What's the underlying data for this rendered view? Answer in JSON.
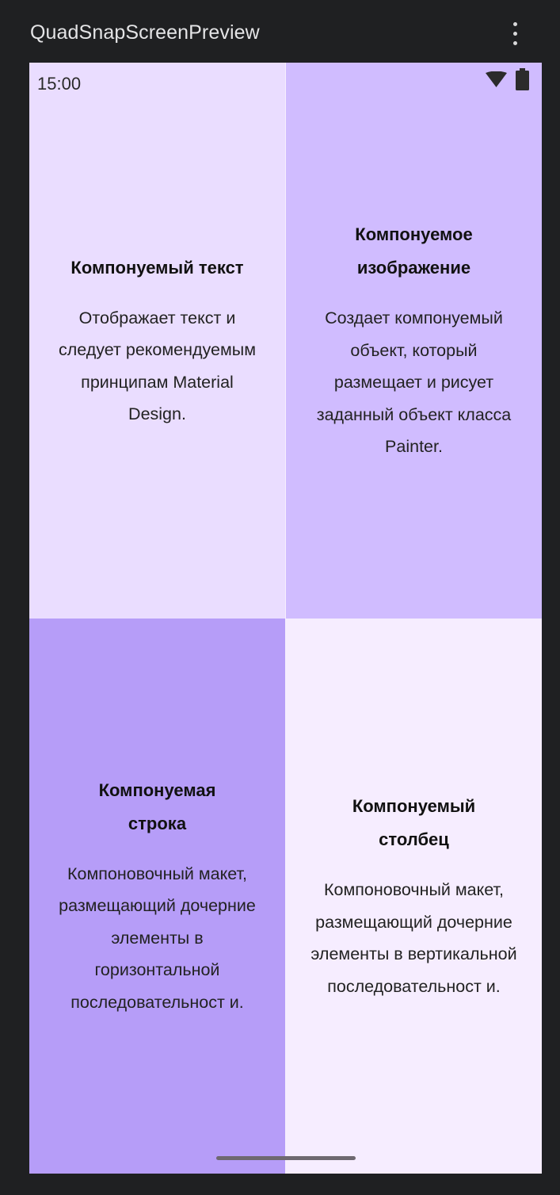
{
  "preview": {
    "title": "QuadSnapScreenPreview",
    "more_icon": "more-vert-icon"
  },
  "status_bar": {
    "time": "15:00",
    "icons": [
      "wifi-icon",
      "battery-icon"
    ]
  },
  "quadrants": [
    {
      "title": "Компонуемый текст",
      "description": "Отображает текст и следует рекомендуемым принципам Material Design.",
      "background": "#eaddff"
    },
    {
      "title": "Компонуемое изображение",
      "description": "Создает компонуемый объект, который размещает и рисует заданный объект класса Painter.",
      "background": "#d0bcff"
    },
    {
      "title": "Компонуемая строка",
      "description": "Компоновочный макет, размещающий дочерние элементы в горизонтальной последовательност и.",
      "background": "#b69df8"
    },
    {
      "title": "Компонуемый столбец",
      "description": "Компоновочный макет, размещающий дочерние элементы в вертикальной последовательност и.",
      "background": "#f6edff"
    }
  ],
  "colors": {
    "window_background": "#1f2022",
    "header_text": "#e4e4e6"
  }
}
